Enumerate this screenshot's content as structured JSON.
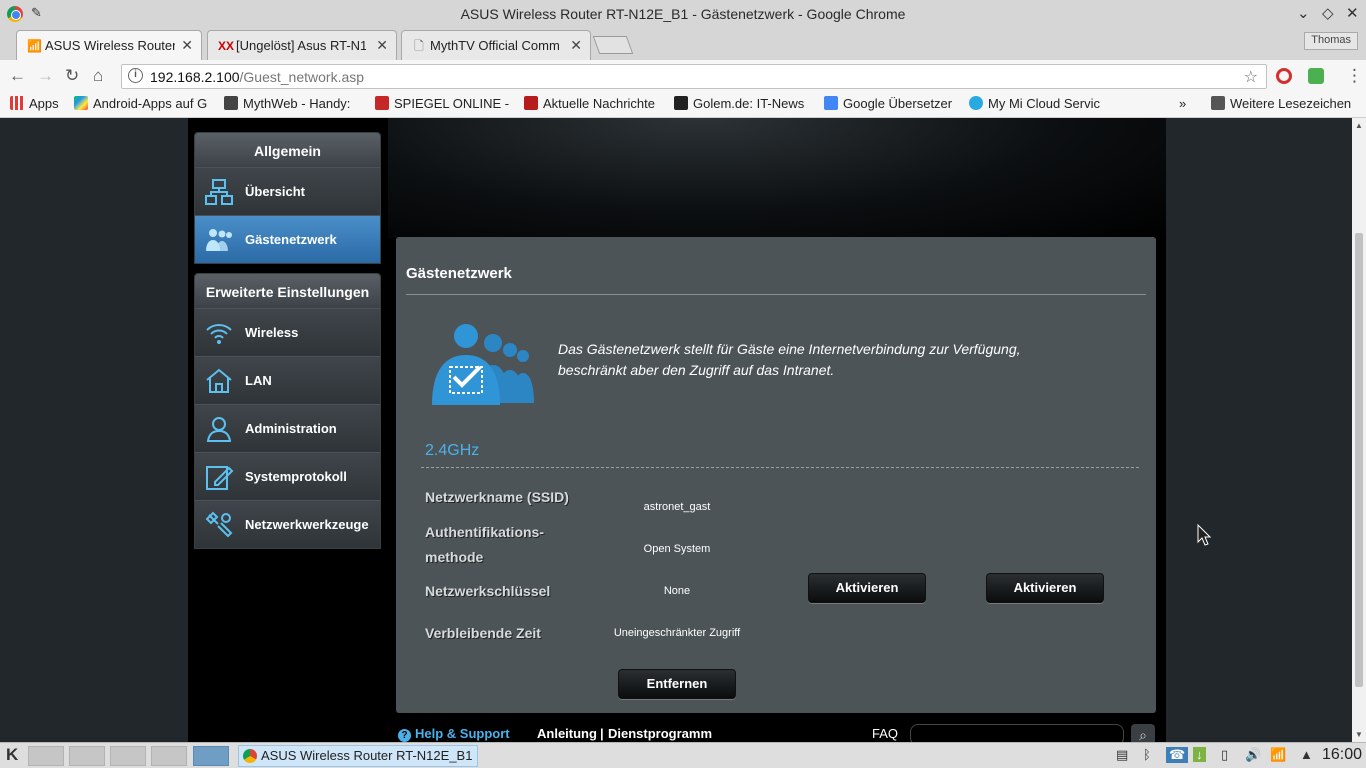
{
  "window": {
    "title": "ASUS Wireless Router RT-N12E_B1 - Gästenetzwerk - Google Chrome"
  },
  "tabs": [
    {
      "label": "ASUS Wireless Router",
      "icon": "wifi-icon",
      "active": true
    },
    {
      "label": "[Ungelöst] Asus RT-N1",
      "icon": "xx-icon",
      "active": false
    },
    {
      "label": "MythTV Official Comm",
      "icon": "page-icon",
      "active": false
    }
  ],
  "profile": {
    "name": "Thomas"
  },
  "address": {
    "host": "192.168.2.100",
    "path": "/Guest_network.asp"
  },
  "bookmarks": [
    {
      "label": "Apps",
      "icon": "apps-grid-icon"
    },
    {
      "label": "Android-Apps auf G",
      "icon": "play-store-icon"
    },
    {
      "label": "MythWeb - Handy:",
      "icon": "mythweb-icon"
    },
    {
      "label": "SPIEGEL ONLINE - N",
      "icon": "spiegel-icon"
    },
    {
      "label": "Aktuelle Nachrichte",
      "icon": "news-icon"
    },
    {
      "label": "Golem.de: IT-News",
      "icon": "golem-icon"
    },
    {
      "label": "Google Übersetzer",
      "icon": "translate-icon"
    },
    {
      "label": "My Mi Cloud Servic",
      "icon": "cloud-icon"
    }
  ],
  "bookmarks_more": "»",
  "bookmarks_folder": "Weitere Lesezeichen",
  "sidebar": {
    "general_header": "Allgemein",
    "general_items": [
      {
        "label": "Übersicht",
        "icon": "network-map-icon",
        "active": false
      },
      {
        "label": "Gästenetzwerk",
        "icon": "guest-users-icon",
        "active": true
      }
    ],
    "advanced_header": "Erweiterte Einstellungen",
    "advanced_items": [
      {
        "label": "Wireless",
        "icon": "wifi-icon"
      },
      {
        "label": "LAN",
        "icon": "home-icon"
      },
      {
        "label": "Administration",
        "icon": "admin-user-icon"
      },
      {
        "label": "Systemprotokoll",
        "icon": "log-edit-icon"
      },
      {
        "label": "Netzwerkwerkzeuge",
        "icon": "tools-icon"
      }
    ]
  },
  "panel": {
    "title": "Gästenetzwerk",
    "description": "Das Gästenetzwerk stellt für Gäste eine Internetverbindung zur Verfügung, beschränkt aber den Zugriff auf das Intranet.",
    "band": "2.4GHz",
    "rows": [
      {
        "label": "Netzwerkname (SSID)",
        "value": "astronet_gast"
      },
      {
        "label": "Authentifikations-methode",
        "value": "Open System"
      },
      {
        "label": "Netzwerkschlüssel",
        "value": "None"
      },
      {
        "label": "Verbleibende Zeit",
        "value": "Uneingeschränkter Zugriff"
      }
    ],
    "enable_button_1": "Aktivieren",
    "enable_button_2": "Aktivieren",
    "remove_button": "Entfernen"
  },
  "footer": {
    "help": "Help & Support",
    "manual": "Anleitung",
    "separator": "|",
    "utility": "Dienstprogramm",
    "faq": "FAQ"
  },
  "taskbar": {
    "app_label": "ASUS Wireless Router RT-N12E_B1",
    "clock": "16:00"
  },
  "colors": {
    "accent_blue": "#4ab1ea",
    "active_menu": "#3a7fbf",
    "panel_bg": "#4d5458"
  }
}
